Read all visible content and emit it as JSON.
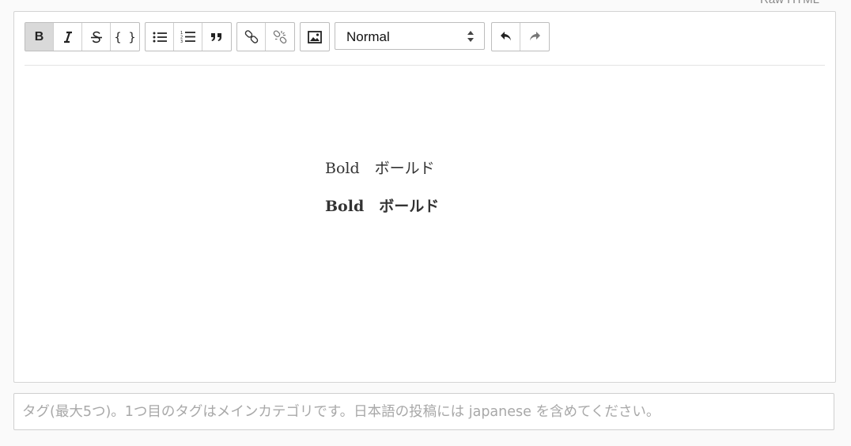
{
  "raw_html_label": "Raw HTML",
  "toolbar": {
    "bold": "B",
    "code": "{ }",
    "heading_select": {
      "value": "Normal"
    }
  },
  "editor": {
    "lines": [
      {
        "text": "Bold　ボールド",
        "bold": false
      },
      {
        "text": "Bold　ボールド",
        "bold": true
      }
    ]
  },
  "tags": {
    "placeholder": "タグ(最大5つ)。1つ目のタグはメインカテゴリです。日本語の投稿には japanese を含めてください。",
    "value": ""
  },
  "icons": [
    "bold-icon",
    "italic-icon",
    "strikethrough-icon",
    "code-icon",
    "bullet-list-icon",
    "numbered-list-icon",
    "quote-icon",
    "link-icon",
    "unlink-icon",
    "image-icon",
    "select-arrows-icon",
    "undo-icon",
    "redo-icon"
  ]
}
